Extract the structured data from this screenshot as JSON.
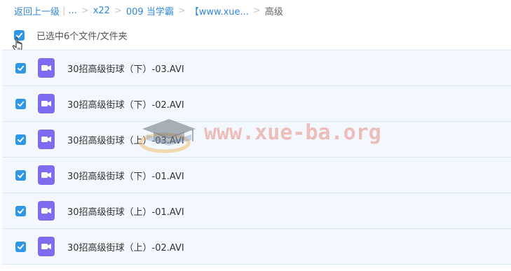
{
  "breadcrumb": {
    "back": "返回上一级",
    "ellipsis": "...",
    "items": [
      "x22",
      "009 当学霸",
      "【www.xue..."
    ],
    "current": "高级"
  },
  "selection": {
    "label": "已选中6个文件/文件夹"
  },
  "files": [
    {
      "name": "30招高级街球（下）-03.AVI"
    },
    {
      "name": "30招高级街球（下）-02.AVI"
    },
    {
      "name": "30招高级街球（上）-03.AVI"
    },
    {
      "name": "30招高级街球（下）-01.AVI"
    },
    {
      "name": "30招高级街球（上）-01.AVI"
    },
    {
      "name": "30招高级街球（上）-02.AVI"
    }
  ],
  "watermark": {
    "text": "www.xue-ba.org",
    "icon": "graduation-cap-icon"
  },
  "colors": {
    "link": "#2f87d8",
    "checkbox": "#2f96e8",
    "row_bg": "#f2f8fe",
    "video_icon": "#7b6cf0"
  }
}
